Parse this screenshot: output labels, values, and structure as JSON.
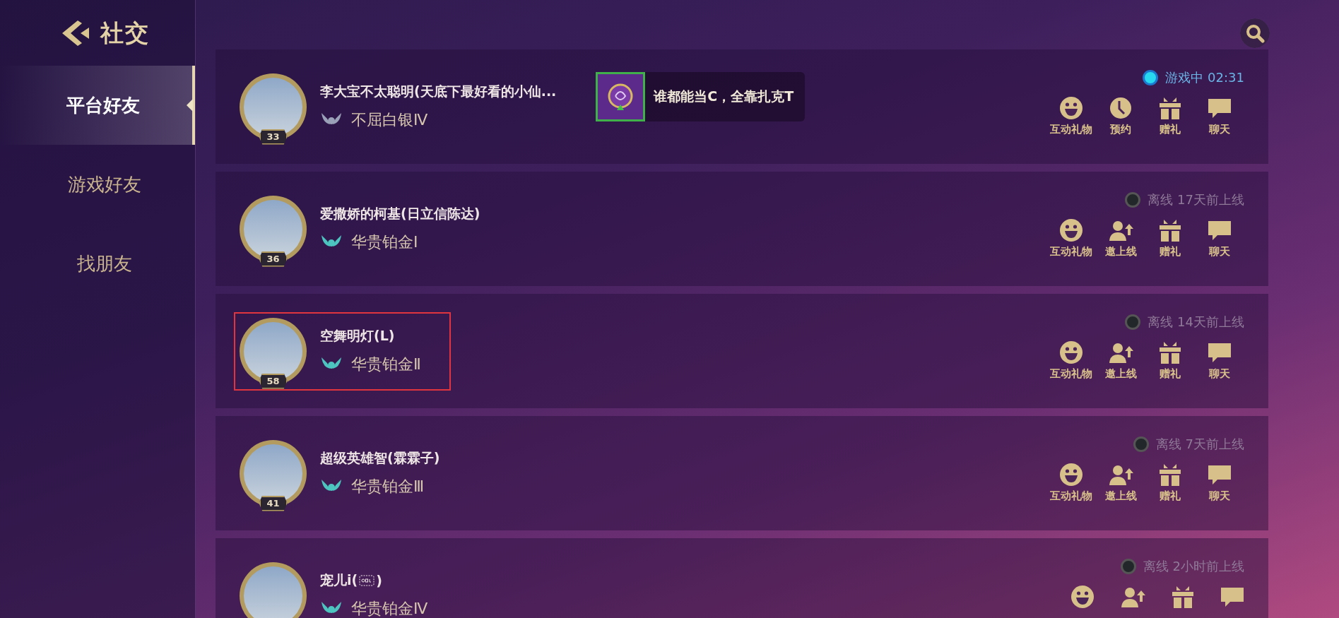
{
  "header": {
    "title": "社交"
  },
  "nav": [
    {
      "label": "平台好友",
      "selected": true
    },
    {
      "label": "游戏好友",
      "selected": false
    },
    {
      "label": "找朋友",
      "selected": false
    }
  ],
  "friends": [
    {
      "name": "李大宝不太聪明(天底下最好看的小仙...",
      "level": "33",
      "rank": "不屈白银Ⅳ",
      "color": "#9aa0b8",
      "highlighted": false,
      "badge": {
        "text": "谁都能当C，全靠扎克T"
      },
      "status": {
        "kind": "online",
        "text": "游戏中 02:31"
      },
      "actions": [
        {
          "kind": "smile",
          "label": "互动礼物"
        },
        {
          "kind": "clock",
          "label": "预约"
        },
        {
          "kind": "gift",
          "label": "赠礼"
        },
        {
          "kind": "chat",
          "label": "聊天"
        }
      ]
    },
    {
      "name": "爱撒娇的柯基(日立信陈达)",
      "level": "36",
      "rank": "华贵铂金Ⅰ",
      "color": "#4cc4c0",
      "highlighted": false,
      "status": {
        "kind": "offline",
        "text": "离线 17天前上线"
      },
      "actions": [
        {
          "kind": "smile",
          "label": "互动礼物"
        },
        {
          "kind": "invite",
          "label": "邀上线"
        },
        {
          "kind": "gift",
          "label": "赠礼"
        },
        {
          "kind": "chat",
          "label": "聊天"
        }
      ]
    },
    {
      "name": "空舞明灯(L)",
      "level": "58",
      "rank": "华贵铂金Ⅱ",
      "color": "#4cc4c0",
      "highlighted": true,
      "status": {
        "kind": "offline",
        "text": "离线 14天前上线"
      },
      "actions": [
        {
          "kind": "smile",
          "label": "互动礼物"
        },
        {
          "kind": "invite",
          "label": "邀上线"
        },
        {
          "kind": "gift",
          "label": "赠礼"
        },
        {
          "kind": "chat",
          "label": "聊天"
        }
      ]
    },
    {
      "name": "超级英雄智(霖霖子)",
      "level": "41",
      "rank": "华贵铂金Ⅲ",
      "color": "#4cc4c0",
      "highlighted": false,
      "status": {
        "kind": "offline",
        "text": "离线 7天前上线"
      },
      "actions": [
        {
          "kind": "smile",
          "label": "互动礼物"
        },
        {
          "kind": "invite",
          "label": "邀上线"
        },
        {
          "kind": "gift",
          "label": "赠礼"
        },
        {
          "kind": "chat",
          "label": "聊天"
        }
      ]
    },
    {
      "name": "宠儿i(",
      "name_icon": {
        "kind": "object"
      },
      "name_end": ")",
      "rank": "华贵铂金Ⅳ",
      "color": "#4cc4c0",
      "highlighted": false,
      "status": {
        "kind": "offline",
        "text": "离线 2小时前上线"
      },
      "actions": [
        {
          "kind": "smile"
        },
        {
          "kind": "invite"
        },
        {
          "kind": "gift"
        },
        {
          "kind": "chat"
        }
      ]
    }
  ]
}
